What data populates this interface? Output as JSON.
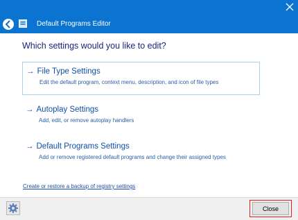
{
  "window": {
    "title": "Default Programs Editor",
    "accent_color": "#0a74d0"
  },
  "icons": {
    "back": "back-arrow-icon",
    "app": "app-icon",
    "close": "close-icon",
    "settings": "gear-icon"
  },
  "main": {
    "heading": "Which settings would you like to edit?",
    "options": [
      {
        "title": "File Type Settings",
        "description": "Edit the default program, context menu, description, and icon of file types"
      },
      {
        "title": "Autoplay Settings",
        "description": "Add, edit, or remove autoplay handlers"
      },
      {
        "title": "Default Programs Settings",
        "description": "Add or remove registered default programs and change their assigned types"
      }
    ],
    "backup_link": "Create or restore a backup of registry settings"
  },
  "footer": {
    "close_label": "Close"
  }
}
